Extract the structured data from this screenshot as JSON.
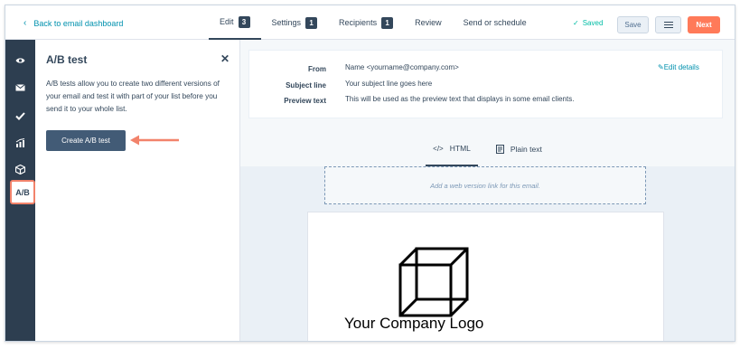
{
  "topbar": {
    "back_label": "Back to email dashboard",
    "tabs": [
      {
        "label": "Edit",
        "badge": "3"
      },
      {
        "label": "Settings",
        "badge": "1"
      },
      {
        "label": "Recipients",
        "badge": "1"
      },
      {
        "label": "Review",
        "badge": ""
      },
      {
        "label": "Send or schedule",
        "badge": ""
      }
    ],
    "saved_label": "Saved",
    "save_label": "Save",
    "next_label": "Next",
    "accent_color": "#ff7a59"
  },
  "rail": {
    "icons": [
      "eye-icon",
      "envelope-icon",
      "check-icon",
      "chart-icon",
      "cube-icon"
    ],
    "ab_label": "A/B"
  },
  "panel": {
    "title": "A/B test",
    "description": "A/B tests allow you to create two different versions of your email and test it with part of your list before you send it to your whole list.",
    "create_button": "Create A/B test"
  },
  "details": {
    "from_label": "From",
    "from_value": "Name <yourname@company.com>",
    "subject_label": "Subject line",
    "subject_value": "Your subject line goes here",
    "preview_label": "Preview text",
    "preview_value": "This will be used as the preview text that displays in some email clients.",
    "edit_label": "Edit details"
  },
  "view_tabs": {
    "html_label": "HTML",
    "plain_label": "Plain text"
  },
  "preview": {
    "web_version_text": "Add a web version link for this email.",
    "logo_text": "Your Company Logo"
  }
}
